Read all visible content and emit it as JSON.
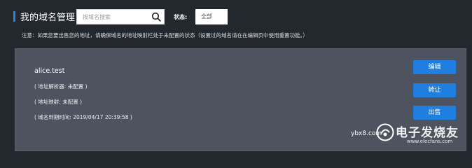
{
  "header": {
    "title": "我的域名管理",
    "search_placeholder": "按域名搜索",
    "status_label": "状态:",
    "status_value": "全部",
    "accent_color": "#2e83d6"
  },
  "notice": "注意：如果您要出售您的地址，请确保域名的地址映射栏处于未配置的状态（设置过的域名请在在编辑页中使用重置功能。）",
  "card": {
    "domain": "alice.test",
    "lines": [
      "( 地址解析器: 未配置 )",
      "( 地址映射: 未配置 )",
      "( 域名到期时间: 2019/04/17 20:39:58 )"
    ],
    "buttons": {
      "edit": "编辑",
      "transfer": "转让",
      "sell": "出售"
    },
    "button_color": "#1f7fe0"
  },
  "watermark": {
    "small": "ybx8.com",
    "big": "电子发烧友",
    "url": "www.elecfans.com"
  }
}
